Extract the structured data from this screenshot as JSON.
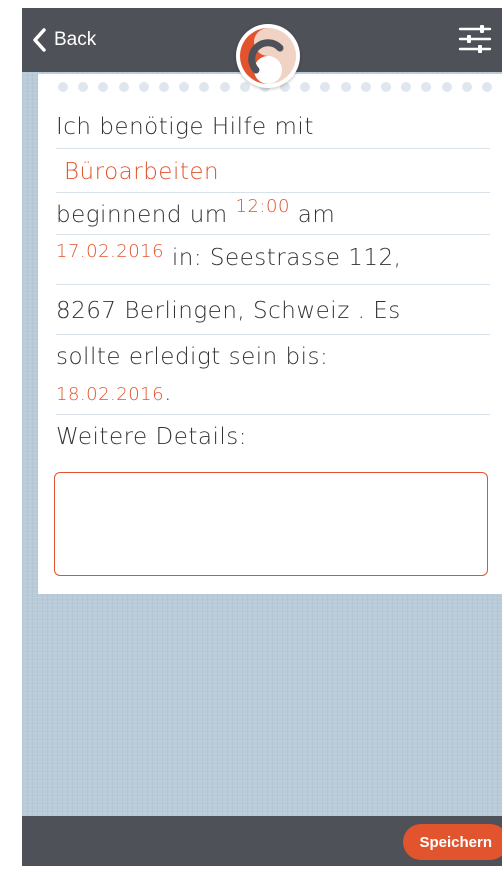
{
  "nav": {
    "back_label": "Back"
  },
  "form": {
    "line1": "Ich benötige Hilfe mit",
    "task": "Büroarbeiten",
    "start_text": "beginnend um",
    "time": "12:00",
    "am_text": "am",
    "date": "17.02.2016",
    "in_text": "in: Seestrasse 112,",
    "address_line2": "8267 Berlingen, Schweiz . Es",
    "until_text": "sollte erledigt sein bis:",
    "due_date": "18.02.2016",
    "period": ".",
    "details_label": "Weitere Details:",
    "details_value": ""
  },
  "footer": {
    "save_label": "Speichern"
  },
  "colors": {
    "accent": "#e2542e",
    "bar": "#4e5258",
    "background": "#b9cad8"
  },
  "icons": [
    "back-chevron-icon",
    "settings-sliders-icon",
    "app-logo-icon"
  ]
}
